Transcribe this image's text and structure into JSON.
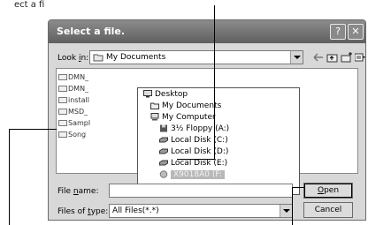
{
  "caption_top": "ect a fi",
  "dialog": {
    "title": "Select a file.",
    "help_glyph": "?",
    "close_glyph": "✕",
    "look_in": {
      "pre": "Look ",
      "key": "i",
      "post": "n:",
      "value": "My Documents"
    },
    "file_list": [
      "DMN_",
      "DMN_",
      "install",
      "MSD_",
      "Sampl",
      "Song"
    ],
    "dropdown_items": [
      {
        "label": "Desktop",
        "icon": "desktop-icon"
      },
      {
        "label": "My Documents",
        "icon": "my-documents-icon"
      },
      {
        "label": "My Computer",
        "icon": "my-computer-icon"
      },
      {
        "label": "3½ Floppy (A:)",
        "icon": "floppy-icon"
      },
      {
        "label": "Local Disk (C:)",
        "icon": "disk-icon"
      },
      {
        "label": "Local Disk (D:)",
        "icon": "disk-icon"
      },
      {
        "label": "Local Disk (E:)",
        "icon": "disk-icon"
      },
      {
        "label": "X9018A0 (F:",
        "icon": "removable-disk-icon"
      }
    ],
    "file_name": {
      "pre": "File ",
      "key": "n",
      "post": "ame:",
      "value": ""
    },
    "files_of_type": {
      "pre": "Files of ",
      "key": "t",
      "post": "ype:",
      "value": "All Files(*.*)"
    },
    "open_button": {
      "key": "O",
      "rest": "pen"
    },
    "cancel_button": "Cancel"
  },
  "colors": {
    "titlebar": "#707070",
    "dialog_bg": "#d8d8d8",
    "selection": "#b8b8b8"
  }
}
